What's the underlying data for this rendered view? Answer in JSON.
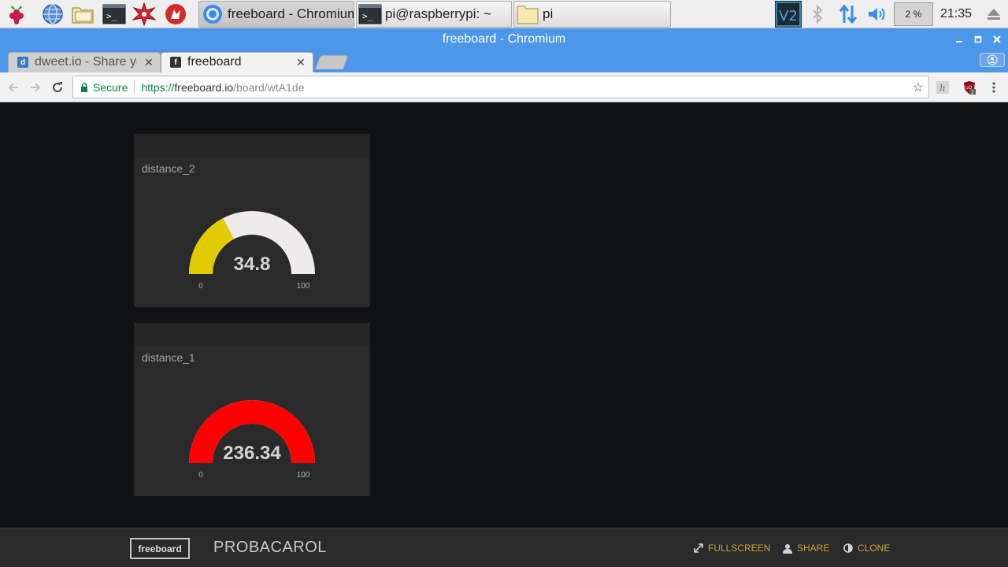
{
  "taskbar": {
    "launchers": [
      "raspberry-menu-icon",
      "web-browser-icon",
      "file-manager-icon",
      "terminal-icon",
      "math-kernel-icon",
      "wolfram-icon"
    ],
    "tasks": [
      {
        "label": "freeboard - Chromium",
        "icon": "chromium-icon",
        "active": true
      },
      {
        "label": "pi@raspberrypi: ~",
        "icon": "terminal-icon",
        "active": false
      },
      {
        "label": "pi",
        "icon": "folder-icon",
        "active": false
      }
    ],
    "cpu_label": "2 %",
    "cpu_usage_fraction": 0.02,
    "clock": "21:35"
  },
  "window": {
    "title": "freeboard - Chromium"
  },
  "browser": {
    "tabs": [
      {
        "label": "dweet.io - Share yo",
        "favicon": "d",
        "active": false
      },
      {
        "label": "freeboard",
        "favicon": "f",
        "active": true
      }
    ],
    "secure_label": "Secure",
    "url_scheme": "https://",
    "url_host": "freeboard.io",
    "url_path": "/board/wtA1de"
  },
  "board": {
    "widgets": [
      {
        "title": "distance_2",
        "value_label": "34.8",
        "value": 34.8,
        "min": 0,
        "max": 100,
        "min_label": "0",
        "max_label": "100",
        "color": "#e0cc00"
      },
      {
        "title": "distance_1",
        "value_label": "236.34",
        "value": 236.34,
        "min": 0,
        "max": 100,
        "min_label": "0",
        "max_label": "100",
        "color": "#ff0000"
      }
    ],
    "gauge_track_color": "#edebeb"
  },
  "footer": {
    "brand": "freeboard",
    "board_name": "PROBACAROL",
    "fullscreen_label": "FULLSCREEN",
    "share_label": "SHARE",
    "clone_label": "CLONE"
  }
}
